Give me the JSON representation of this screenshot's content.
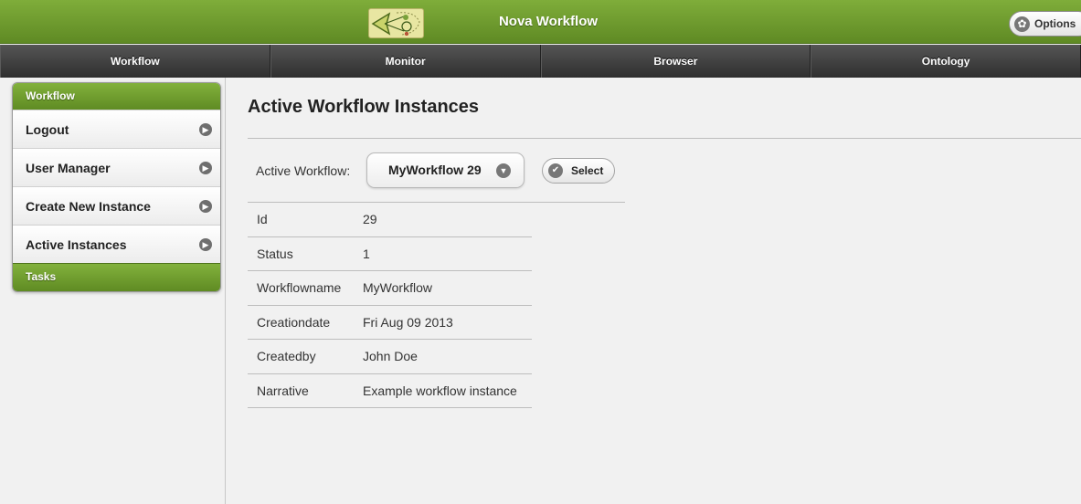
{
  "header": {
    "title": "Nova Workflow",
    "options_label": "Options",
    "brand_color": "#6f9b2e"
  },
  "nav": {
    "items": [
      "Workflow",
      "Monitor",
      "Browser",
      "Ontology"
    ]
  },
  "sidebar": {
    "header": "Workflow",
    "items": [
      {
        "label": "Logout",
        "icon": "chevron-right-icon"
      },
      {
        "label": "User Manager",
        "icon": "chevron-right-icon"
      },
      {
        "label": "Create New Instance",
        "icon": "chevron-right-icon"
      },
      {
        "label": "Active Instances",
        "icon": "chevron-right-icon"
      }
    ],
    "footer": "Tasks"
  },
  "main": {
    "title": "Active Workflow Instances",
    "active_workflow_label": "Active Workflow:",
    "selected_workflow": "MyWorkflow 29",
    "select_button": "Select",
    "details": [
      {
        "key": "Id",
        "value": "29"
      },
      {
        "key": "Status",
        "value": "1"
      },
      {
        "key": "Workflowname",
        "value": "MyWorkflow"
      },
      {
        "key": "Creationdate",
        "value": "Fri Aug 09 2013"
      },
      {
        "key": "Createdby",
        "value": "John Doe"
      },
      {
        "key": "Narrative",
        "value": "Example workflow instance"
      }
    ]
  }
}
